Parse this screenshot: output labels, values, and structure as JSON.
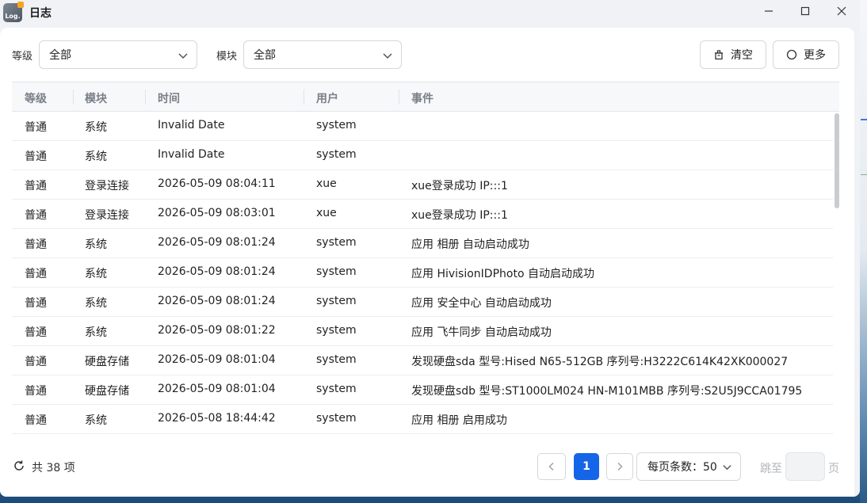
{
  "window": {
    "title": "日志",
    "logo_text": "Log."
  },
  "filters": {
    "level_label": "等级",
    "level_value": "全部",
    "module_label": "模块",
    "module_value": "全部"
  },
  "actions": {
    "clear_label": "清空",
    "more_label": "更多"
  },
  "table": {
    "columns": [
      "等级",
      "模块",
      "时间",
      "用户",
      "事件"
    ],
    "rows": [
      [
        "普通",
        "系统",
        "Invalid Date",
        "system",
        ""
      ],
      [
        "普通",
        "系统",
        "Invalid Date",
        "system",
        ""
      ],
      [
        "普通",
        "登录连接",
        "2026-05-09 08:04:11",
        "xue",
        "xue登录成功 IP:::1"
      ],
      [
        "普通",
        "登录连接",
        "2026-05-09 08:03:01",
        "xue",
        "xue登录成功 IP:::1"
      ],
      [
        "普通",
        "系统",
        "2026-05-09 08:01:24",
        "system",
        "应用 相册 自动启动成功"
      ],
      [
        "普通",
        "系统",
        "2026-05-09 08:01:24",
        "system",
        "应用 HivisionIDPhoto 自动启动成功"
      ],
      [
        "普通",
        "系统",
        "2026-05-09 08:01:24",
        "system",
        "应用 安全中心 自动启动成功"
      ],
      [
        "普通",
        "系统",
        "2026-05-09 08:01:22",
        "system",
        "应用 飞牛同步 自动启动成功"
      ],
      [
        "普通",
        "硬盘存储",
        "2026-05-09 08:01:04",
        "system",
        "发现硬盘sda 型号:Hised N65-512GB 序列号:H3222C614K42XK000027"
      ],
      [
        "普通",
        "硬盘存储",
        "2026-05-09 08:01:04",
        "system",
        "发现硬盘sdb 型号:ST1000LM024 HN-M101MBB 序列号:S2U5J9CCA01795"
      ],
      [
        "普通",
        "系统",
        "2026-05-08 18:44:42",
        "system",
        "应用 相册 启用成功"
      ]
    ]
  },
  "pagination": {
    "total_text": "共 38 项",
    "current_page": "1",
    "page_size_text": "每页条数：50",
    "jump_label": "跳至",
    "jump_value": "",
    "jump_suffix": "页"
  },
  "icons": {
    "refresh": "refresh-icon",
    "clear": "trash-icon",
    "more": "circle-icon",
    "prev": "chevron-left-icon",
    "next": "chevron-right-icon",
    "dropdown": "chevron-down-icon"
  },
  "colors": {
    "accent": "#1565e8"
  }
}
